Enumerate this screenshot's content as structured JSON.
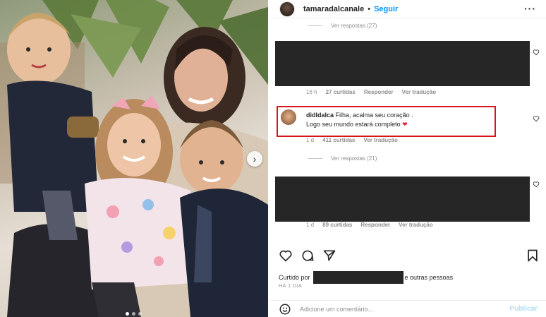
{
  "post": {
    "username": "tamaradalcanale",
    "dot": "•",
    "follow_label": "Seguir",
    "more_icon": "more-horizontal-icon"
  },
  "comments": {
    "replies_top": "Ver respostas (27)",
    "comment1": {
      "time": "16 h",
      "likes": "27 curtidas",
      "reply": "Responder",
      "translate": "Ver tradução"
    },
    "highlighted": {
      "username": "didIdalca",
      "text_line1": "Filha, acalma seu coração .",
      "text_line2": "Logo seu mundo estará completo",
      "emoji": "❤",
      "time": "1 d",
      "likes": "411 curtidas",
      "translate": "Ver tradução",
      "highlight_color": "#d7161b"
    },
    "replies_mid": "Ver respostas (21)",
    "comment3": {
      "time": "1 d",
      "likes": "89 curtidas",
      "reply": "Responder",
      "translate": "Ver tradução"
    }
  },
  "footer": {
    "liked_prefix": "Curtido por",
    "liked_suffix": "e outras pessoas",
    "ago": "HÁ 1 DIA",
    "add_placeholder": "Adicione um comentário...",
    "publish_label": "Publicar"
  },
  "colors": {
    "accent": "#0095f6",
    "publish_disabled": "#b2dffc",
    "text": "#262626",
    "muted": "#8e8e8e"
  }
}
